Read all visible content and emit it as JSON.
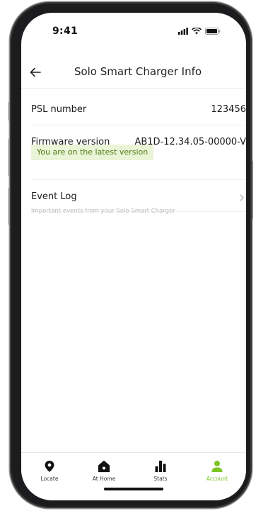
{
  "status_bar": {
    "time": "9:41"
  },
  "header": {
    "title": "Solo Smart Charger Info"
  },
  "psl": {
    "label": "PSL number",
    "value": "123456"
  },
  "firmware": {
    "label": "Firmware version",
    "value": "AB1D-12.34.05-00000-V",
    "status": "You are on the latest version"
  },
  "event_log": {
    "label": "Event Log",
    "description": "Important events from your Solo Smart Charger"
  },
  "tabs": [
    {
      "label": "Locate",
      "icon": "location-pin-icon"
    },
    {
      "label": "At Home",
      "icon": "home-icon"
    },
    {
      "label": "Stats",
      "icon": "bar-chart-icon"
    },
    {
      "label": "Account",
      "icon": "person-icon",
      "active": true
    }
  ],
  "colors": {
    "accent": "#7cc524",
    "badge_bg": "#eaf4d7",
    "badge_text": "#4c7a10"
  }
}
